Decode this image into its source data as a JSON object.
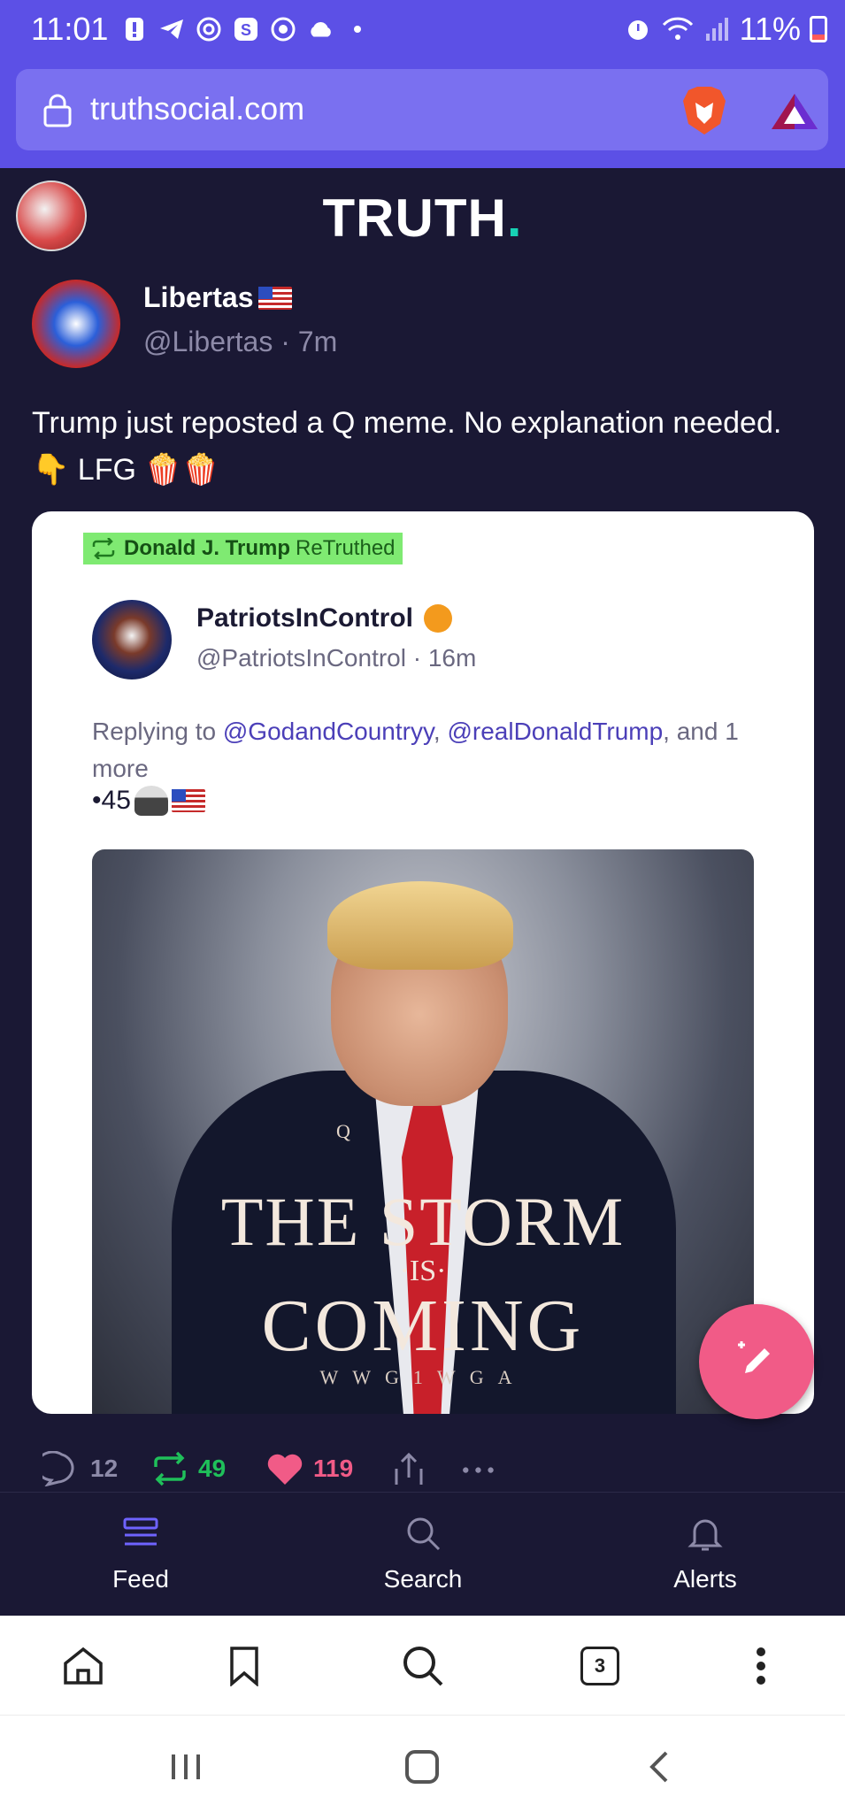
{
  "status_bar": {
    "time": "11:01",
    "battery": "11%"
  },
  "browser": {
    "url": "truthsocial.com",
    "tab_count": "3"
  },
  "app": {
    "logo_text": "TRUTH",
    "logo_dot": ".",
    "accent_color": "#5c50e6",
    "dot_color": "#17d1b4"
  },
  "post": {
    "author_name": "Libertas",
    "author_handle": "@Libertas",
    "time": "7m",
    "text": "Trump just reposted a Q meme. No explanation needed. 👇 LFG 🍿🍿",
    "retruth": {
      "name": "Donald J. Trump",
      "label": "ReTruthed"
    },
    "quoted": {
      "author_name": "PatriotsInControl",
      "author_handle": "@PatriotsInControl",
      "time": "16m",
      "replying_prefix": "Replying to",
      "mention_1": "@GodandCountryy",
      "mention_2": "@realDonaldTrump",
      "replying_suffix": ", and 1 more",
      "extra": "•45",
      "image": {
        "q": "Q",
        "line1": "THE STORM",
        "line2": "·IS·",
        "line3": "COMING",
        "line4": "WWG1WGA"
      }
    },
    "counts": {
      "replies": "12",
      "retruths": "49",
      "likes": "119"
    }
  },
  "app_tabs": {
    "feed": "Feed",
    "search": "Search",
    "alerts": "Alerts"
  }
}
